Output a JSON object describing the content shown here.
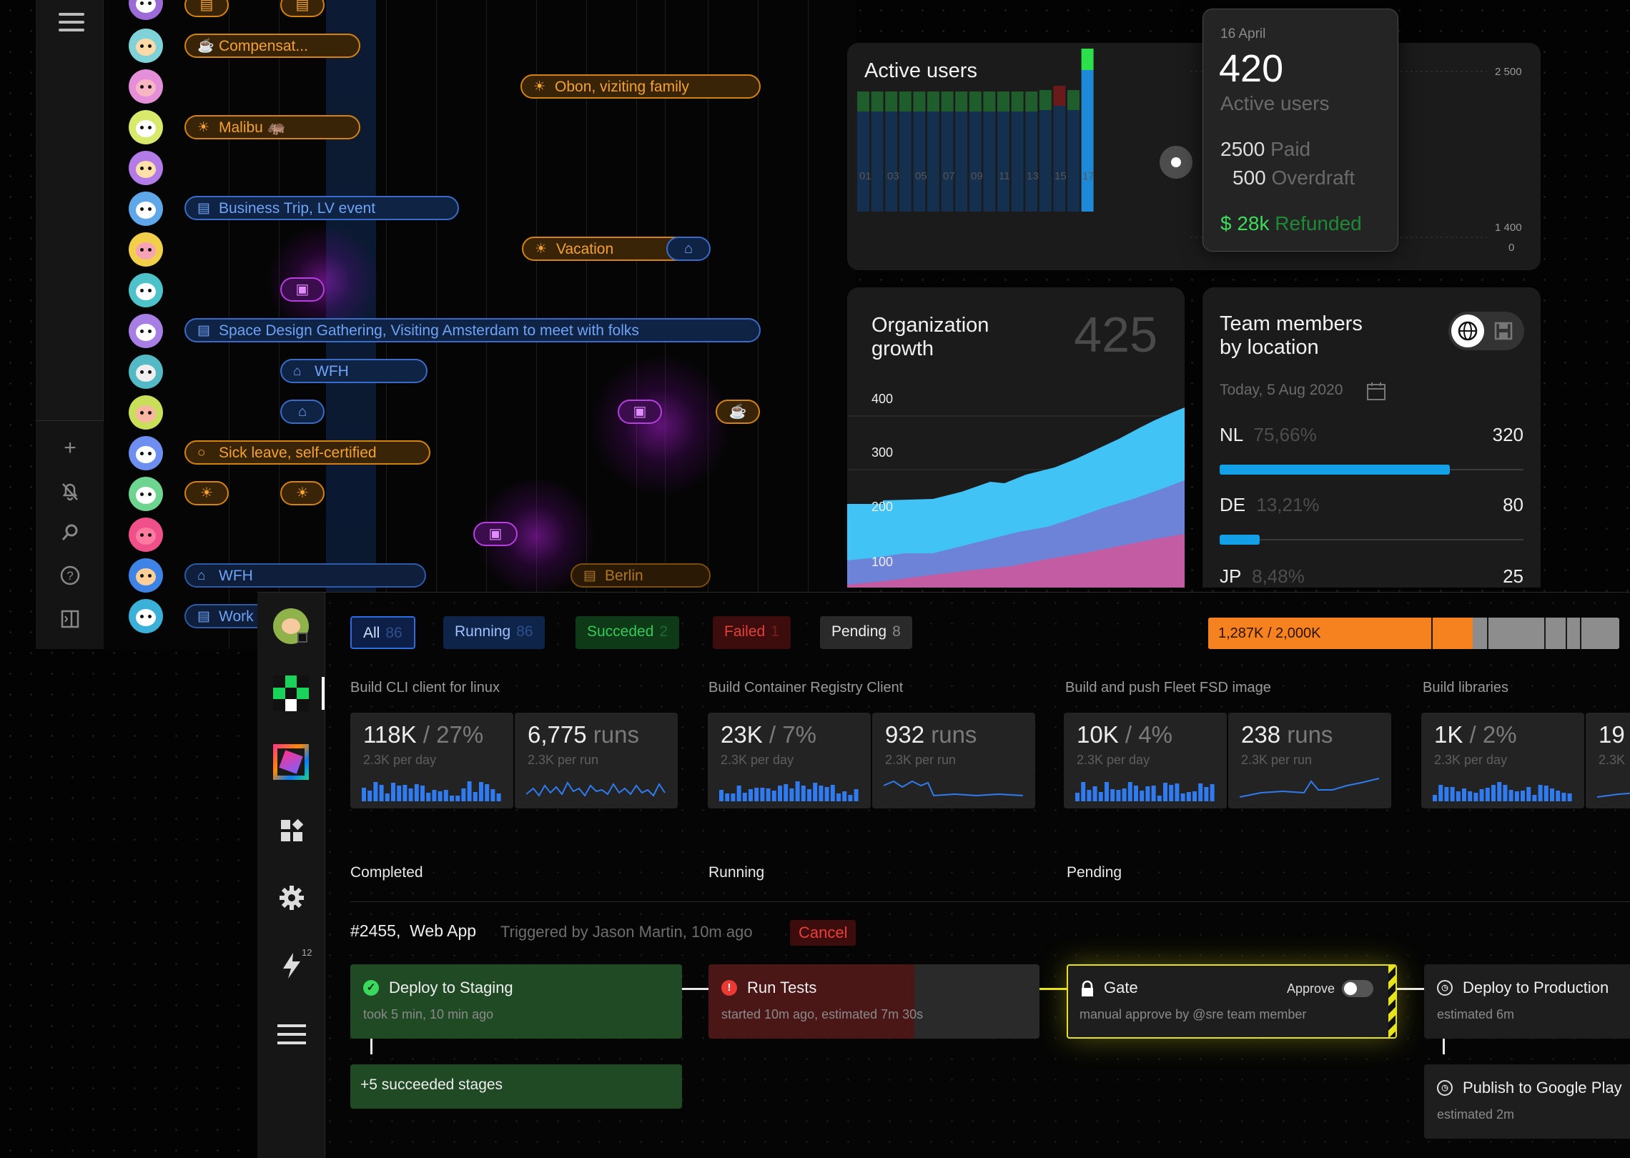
{
  "calendar": {
    "events": {
      "compensation": "Compensat...",
      "obon": "Obon, viziting family",
      "malibu": "Malibu 🦛",
      "business_trip": "Business Trip, LV event",
      "vacation": "Vacation",
      "space_design": "Space Design Gathering, Visiting Amsterdam to meet with folks",
      "wfh1": "WFH",
      "sick_leave": "Sick leave, self-certified",
      "wfh2": "WFH",
      "berlin": "Berlin",
      "work": "Work"
    }
  },
  "active_users": {
    "title": "Active users",
    "x_ticks": [
      "01",
      "03",
      "05",
      "07",
      "09",
      "11",
      "13",
      "15",
      "17"
    ],
    "y_ticks": [
      "2 500",
      "1 400",
      "0"
    ],
    "tooltip": {
      "date": "16 April",
      "value": "420",
      "value_label": "Active users",
      "paid_value": "2500",
      "paid_label": "Paid",
      "overdraft_value": "500",
      "overdraft_label": "Overdraft",
      "refunded_value": "$ 28k",
      "refunded_label": "Refunded"
    }
  },
  "org_growth": {
    "title_line1": "Organization",
    "title_line2": "growth",
    "value": "425",
    "y_ticks": [
      "400",
      "300",
      "200",
      "100"
    ]
  },
  "team_location": {
    "title_line1": "Team members",
    "title_line2": "by location",
    "date": "Today, 5 Aug 2020",
    "rows": [
      {
        "code": "NL",
        "pct": "75,66%",
        "count": "320",
        "fill": 0.7566
      },
      {
        "code": "DE",
        "pct": "13,21%",
        "count": "80",
        "fill": 0.1321
      },
      {
        "code": "JP",
        "pct": "8,48%",
        "count": "25",
        "fill": 0.0848
      }
    ]
  },
  "ci": {
    "filters": [
      {
        "label": "All",
        "count": "86"
      },
      {
        "label": "Running",
        "count": "86"
      },
      {
        "label": "Succeded",
        "count": "2"
      },
      {
        "label": "Failed",
        "count": "1"
      },
      {
        "label": "Pending",
        "count": "8"
      }
    ],
    "quota": {
      "text": "1,287K / 2,000K",
      "fill": 0.6435
    },
    "jobs": [
      {
        "title": "Build CLI client for linux",
        "big": "118K",
        "pct": "/ 27%",
        "sub1": "2.3K per day",
        "runs": "6,775",
        "runs_unit": "runs",
        "sub2": "2.3K per run"
      },
      {
        "title": "Build Container Registry Client",
        "big": "23K",
        "pct": "/ 7%",
        "sub1": "2.3K per day",
        "runs": "932",
        "runs_unit": "runs",
        "sub2": "2.3K per run"
      },
      {
        "title": "Build and push Fleet FSD image",
        "big": "10K",
        "pct": "/ 4%",
        "sub1": "2.3K per day",
        "runs": "238",
        "runs_unit": "runs",
        "sub2": "2.3K per run"
      },
      {
        "title": "Build libraries",
        "big": "1K",
        "pct": "/ 2%",
        "sub1": "2.3K per day",
        "runs": "19",
        "runs_unit": "",
        "sub2": "2.3K"
      }
    ],
    "columns": {
      "completed": "Completed",
      "running": "Running",
      "pending": "Pending"
    },
    "pipeline": {
      "id": "#2455,",
      "name": "Web App",
      "trigger": "Triggered by Jason Martin, 10m ago",
      "cancel": "Cancel"
    },
    "stages": {
      "deploy_staging": {
        "name": "Deploy to Staging",
        "sub": "took 5 min, 10 min ago"
      },
      "succeeded_more": "+5 succeeded stages",
      "run_tests": {
        "name": "Run Tests",
        "sub": "started 10m ago, estimated 7m 30s"
      },
      "gate": {
        "name": "Gate",
        "approve": "Approve",
        "sub": "manual approve by @sre team member"
      },
      "deploy_prod": {
        "name": "Deploy to Production",
        "sub": "estimated 6m"
      },
      "publish_gp": {
        "name": "Publish to Google Play",
        "sub": "estimated 2m"
      }
    },
    "nav_badge": "12"
  },
  "colors": {
    "accent_blue": "#14a0e6",
    "orange": "#f6821f",
    "green": "#2db84a",
    "red": "#e0302a",
    "gate_yellow": "#e6e21c"
  }
}
